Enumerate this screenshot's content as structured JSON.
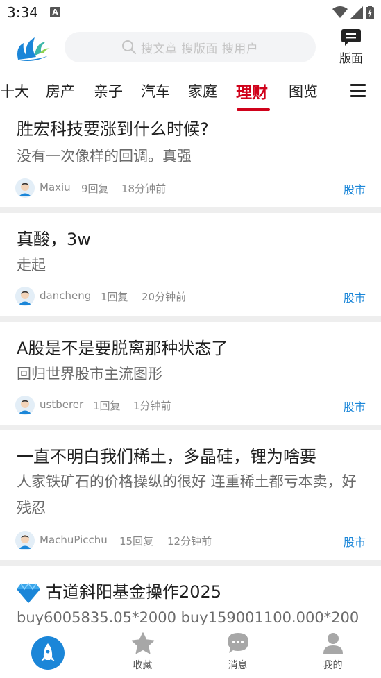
{
  "status_bar": {
    "time": "3:34",
    "notif_letter": "A"
  },
  "header": {
    "search_placeholder": "搜文章 搜版面 搜用户",
    "layout_label": "版面"
  },
  "tabs": [
    "十大",
    "房产",
    "亲子",
    "汽车",
    "家庭",
    "理财",
    "图览"
  ],
  "active_tab": "理财",
  "posts": [
    {
      "title": "胜宏科技要涨到什么时候?",
      "body": "没有一次像样的回调。真强",
      "user": "Maxiu",
      "replies": "9回复",
      "time": "18分钟前",
      "category": "股市"
    },
    {
      "title": "真酸，3w",
      "body": "走起",
      "user": "dancheng",
      "replies": "1回复",
      "time": "20分钟前",
      "category": "股市"
    },
    {
      "title": "A股是不是要脱离那种状态了",
      "body": "回归世界股市主流图形",
      "user": "ustberer",
      "replies": "1回复",
      "time": "1分钟前",
      "category": "股市"
    },
    {
      "title": "一直不明白我们稀土，多晶硅，锂为啥要",
      "body": "人家铁矿石的价格操纵的很好 连重稀土都亏本卖，好残忍",
      "user": "MachuPicchu",
      "replies": "15回复",
      "time": "12分钟前",
      "category": "股市"
    },
    {
      "title": "古道斜阳基金操作2025",
      "body": "buy6005835.05*2000 buy159001100.000*200"
    }
  ],
  "bottom_nav": {
    "favorites": "收藏",
    "messages": "消息",
    "mine": "我的"
  },
  "colors": {
    "accent_red": "#d0021b",
    "link_blue": "#1b86d8",
    "divider": "#eeeeee"
  }
}
